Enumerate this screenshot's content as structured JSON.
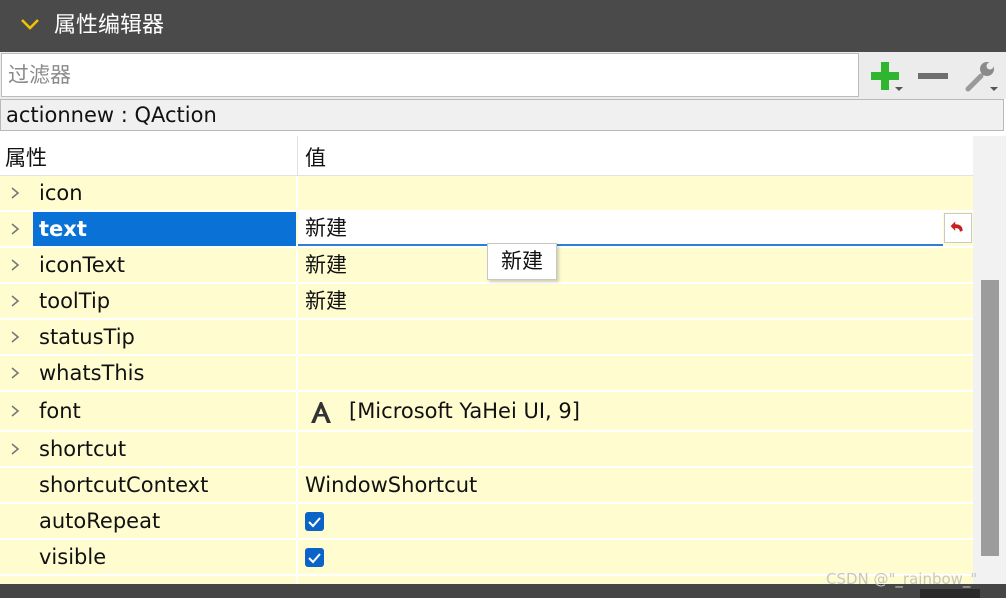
{
  "panel": {
    "title": "属性编辑器"
  },
  "filter": {
    "placeholder": "过滤器",
    "value": ""
  },
  "toolbar": {
    "add": "add-plus-icon",
    "remove": "remove-minus-icon",
    "configure": "wrench-icon"
  },
  "object": {
    "label": "actionnew : QAction"
  },
  "table": {
    "headers": {
      "property": "属性",
      "value": "值"
    },
    "rows": [
      {
        "name": "icon",
        "value": "",
        "expandable": true
      },
      {
        "name": "text",
        "value": "新建",
        "expandable": true,
        "selected": true,
        "editing": true
      },
      {
        "name": "iconText",
        "value": "新建",
        "expandable": true
      },
      {
        "name": "toolTip",
        "value": "新建",
        "expandable": true
      },
      {
        "name": "statusTip",
        "value": "",
        "expandable": true
      },
      {
        "name": "whatsThis",
        "value": "",
        "expandable": true
      },
      {
        "name": "font",
        "value": "[Microsoft YaHei UI, 9]",
        "expandable": true,
        "icon": "font-icon"
      },
      {
        "name": "shortcut",
        "value": "",
        "expandable": true
      },
      {
        "name": "shortcutContext",
        "value": "WindowShortcut",
        "expandable": false
      },
      {
        "name": "autoRepeat",
        "value": "",
        "checked": true,
        "expandable": false
      },
      {
        "name": "visible",
        "value": "",
        "checked": true,
        "expandable": false
      }
    ]
  },
  "tooltip": {
    "text": "新建"
  },
  "watermark": {
    "text": "CSDN @\"_rainbow_\""
  },
  "colors": {
    "selection": "#0a72d6",
    "row": "#fffdd0",
    "titlebar": "#4a4a4a",
    "checkbox": "#0a64c8",
    "add": "#2fb52f"
  }
}
